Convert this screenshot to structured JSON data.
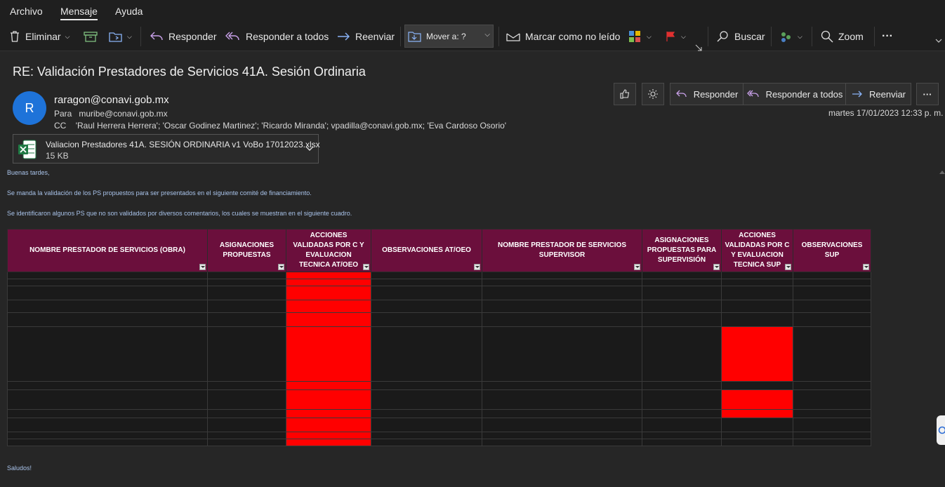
{
  "menu": [
    "Archivo",
    "Mensaje",
    "Ayuda"
  ],
  "toolbar": {
    "delete": "Eliminar",
    "reply": "Responder",
    "reply_all": "Responder a todos",
    "forward": "Reenviar",
    "move": "Mover a: ?",
    "mark_unread": "Marcar como no leído",
    "search": "Buscar",
    "zoom": "Zoom",
    "more": "···"
  },
  "email": {
    "subject": "RE: Validación Prestadores de Servicios 41A. Sesión Ordinaria",
    "avatar_initial": "R",
    "sender": "raragon@conavi.gob.mx",
    "to_label": "Para",
    "to": "muribe@conavi.gob.mx",
    "cc_label": "CC",
    "cc": "'Raul Herrera Herrera'; 'Oscar Godinez Martinez'; 'Ricardo Miranda'; vpadilla@conavi.gob.mx; 'Eva Cardoso Osorio'",
    "date": "martes 17/01/2023 12:33 p. m.",
    "actions": {
      "reply": "Responder",
      "reply_all": "Responder a todos",
      "forward": "Reenviar"
    },
    "attachment": {
      "name": "Valiacion Prestadores 41A. SESIÓN ORDINARIA v1 VoBo 17012023.xlsx",
      "size": "15 KB"
    }
  },
  "body": {
    "greeting": "Buenas tardes,",
    "line1": "Se manda la validación de los PS propuestos para ser presentados en el siguiente comité de financiamiento.",
    "line2": "Se identificaron algunos PS que no son validados por diversos comentarios, los cuales se muestran en el siguiente cuadro.",
    "closing": "Saludos!"
  },
  "table": {
    "headers": [
      "NOMBRE PRESTADOR DE SERVICIOS (OBRA)",
      "ASIGNACIONES PROPUESTAS",
      "ACCIONES VALIDADAS POR C Y EVALUACION TECNICA AT/OEO",
      "OBSERVACIONES AT/OEO",
      "NOMBRE PRESTADOR DE SERVICIOS SUPERVISOR",
      "ASIGNACIONES PROPUESTAS PARA SUPERVISIÓN",
      "ACCIONES VALIDADAS POR C Y EVALUACION TECNICA SUP",
      "OBSERVACIONES SUP"
    ]
  },
  "colors": {
    "header_bg": "#6b0f3c",
    "red_cell": "#ff0000",
    "avatar": "#1e73d9",
    "body_text": "#a9c3ea"
  }
}
